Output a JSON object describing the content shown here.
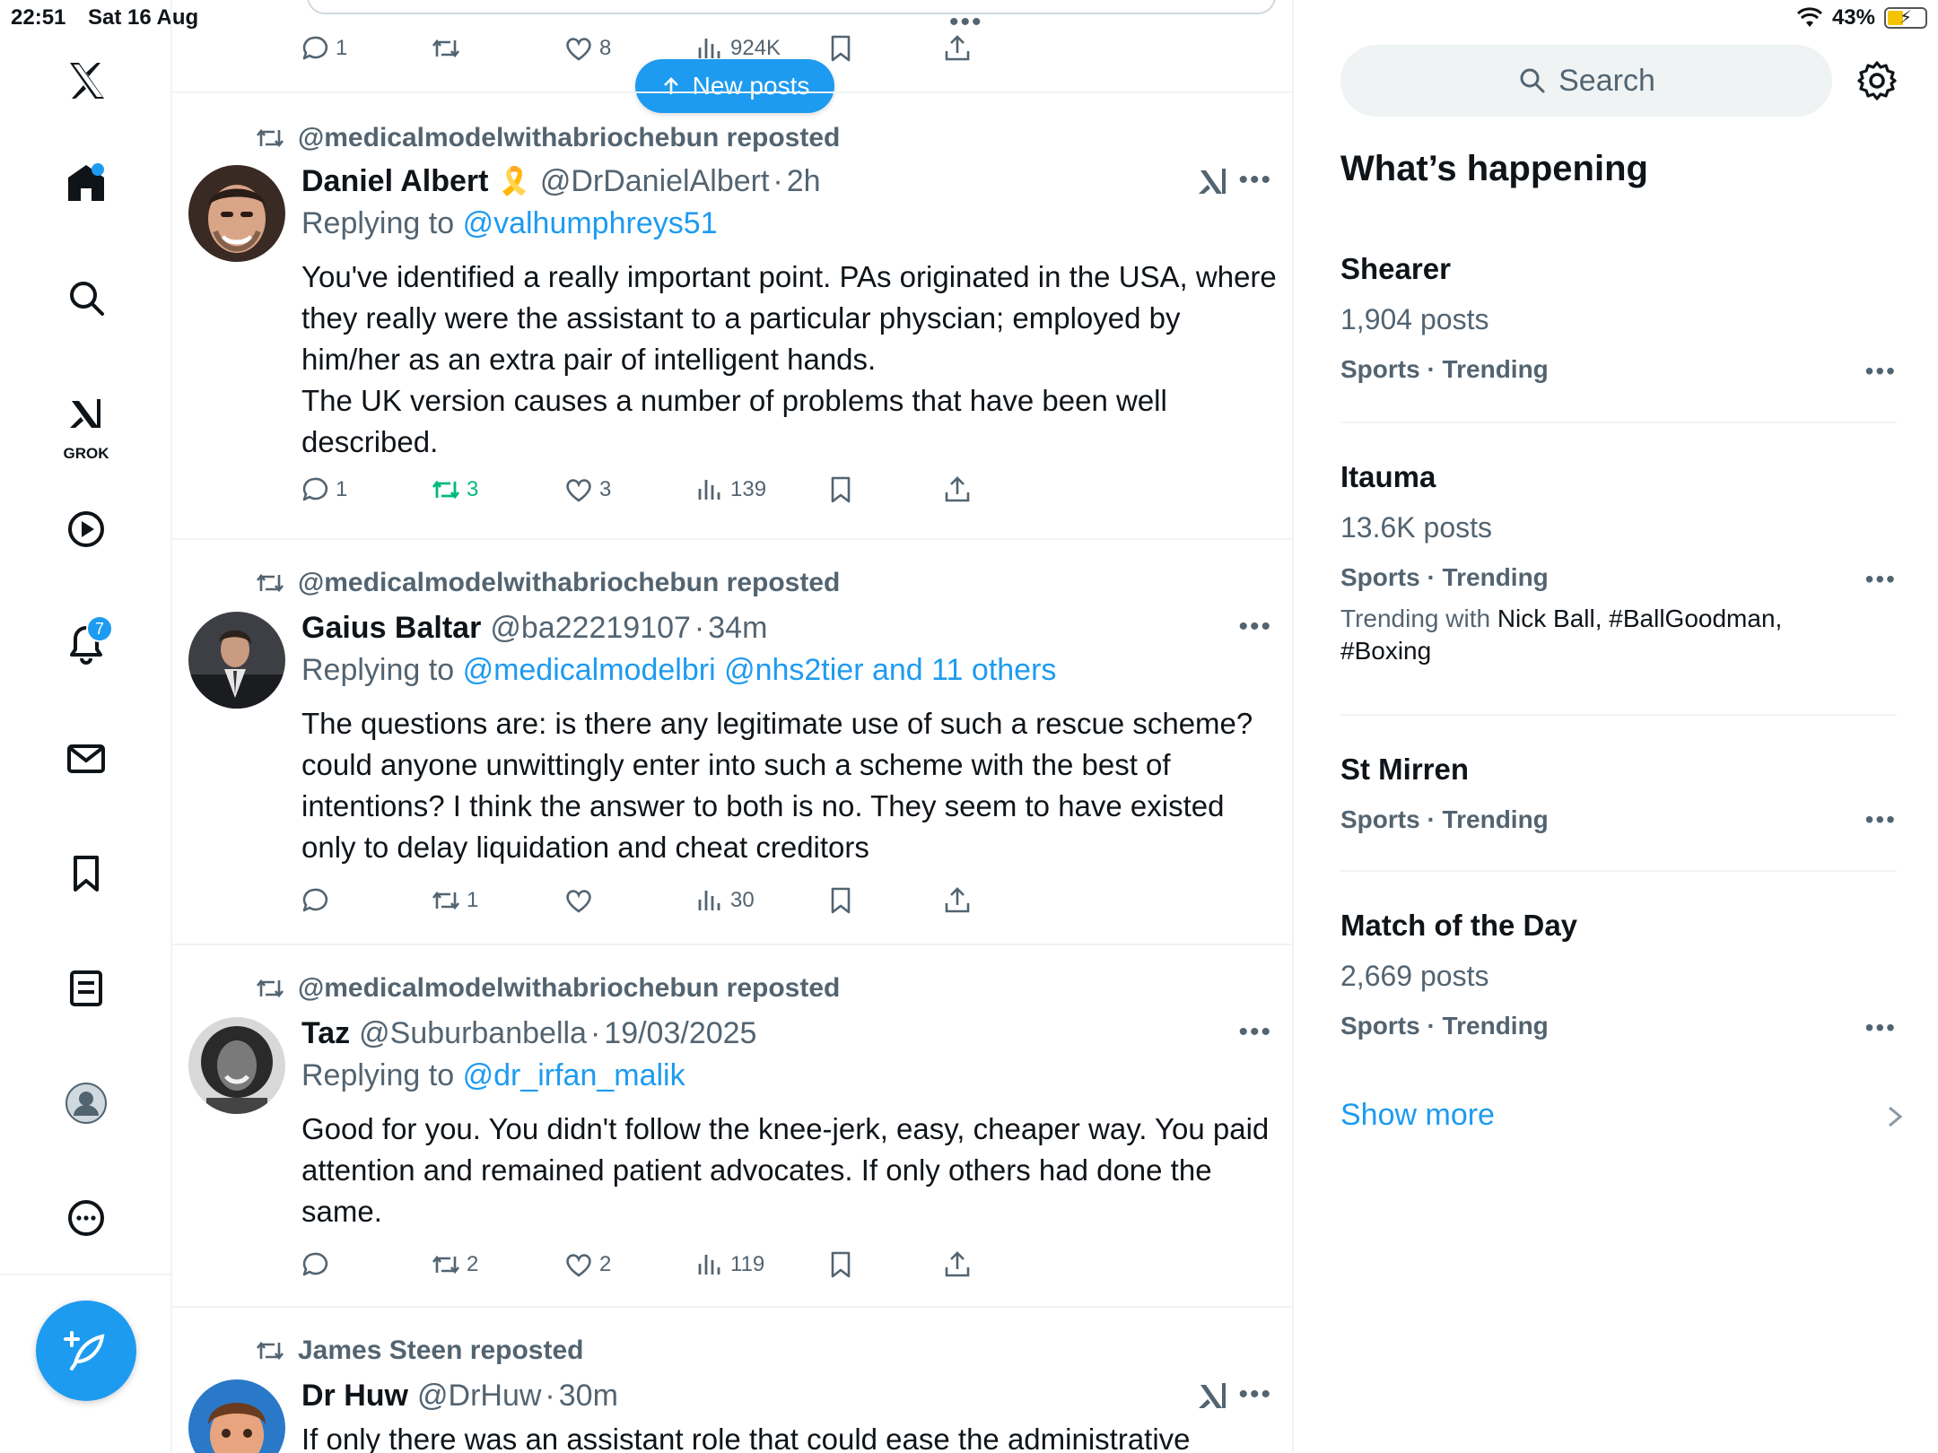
{
  "status_bar": {
    "time": "22:51",
    "date": "Sat 16 Aug",
    "battery": "43%",
    "battery_level": 0.43
  },
  "nav": {
    "items": [
      {
        "name": "x-logo",
        "icon": "x-logo-icon"
      },
      {
        "name": "home",
        "icon": "home-icon",
        "has_dot": true
      },
      {
        "name": "explore",
        "icon": "search-icon"
      },
      {
        "name": "grok",
        "icon": "grok-icon",
        "label": "GROK"
      },
      {
        "name": "videos",
        "icon": "play-icon"
      },
      {
        "name": "notifications",
        "icon": "bell-icon",
        "badge": "7"
      },
      {
        "name": "messages",
        "icon": "mail-icon"
      },
      {
        "name": "bookmarks",
        "icon": "bookmark-icon"
      },
      {
        "name": "lists",
        "icon": "list-icon"
      },
      {
        "name": "profile",
        "icon": "profile-icon"
      },
      {
        "name": "more",
        "icon": "more-circle-icon"
      }
    ],
    "compose_icon": "compose-feather-icon"
  },
  "feed": {
    "new_posts_label": "New posts",
    "top_actions": {
      "replies": "1",
      "reposts": "",
      "likes": "8",
      "views": "924K"
    },
    "tweets": [
      {
        "reposted_by": "@medicalmodelwithabriochebun reposted",
        "name": "Daniel Albert",
        "emoji": "🎗️",
        "handle": "@DrDanielAlbert",
        "separator": "·",
        "time": "2h",
        "replying_prefix": "Replying to",
        "replying_to": "@valhumphreys51",
        "body": "You've identified a really important point. PAs originated in the USA, where they really were the assistant to a particular physcian; employed by him/her as an extra pair of intelligent hands.\nThe UK version causes a number of problems that have been well described.",
        "replies": "1",
        "reposts": "3",
        "likes": "3",
        "views": "139",
        "reposted_by_me": true
      },
      {
        "reposted_by": "@medicalmodelwithabriochebun reposted",
        "name": "Gaius Baltar",
        "handle": "@ba22219107",
        "separator": "·",
        "time": "34m",
        "replying_prefix": "Replying to",
        "replying_to": "@medicalmodelbri @nhs2tier and 11 others",
        "body": "The questions are: is there any legitimate use of such a rescue scheme? could anyone unwittingly enter into such a scheme with the best of intentions? I think the answer to both is no. They seem to have existed only to delay liquidation and cheat creditors",
        "replies": "",
        "reposts": "1",
        "likes": "",
        "views": "30"
      },
      {
        "reposted_by": "@medicalmodelwithabriochebun reposted",
        "name": "Taz",
        "handle": "@Suburbanbella",
        "separator": "·",
        "time": "19/03/2025",
        "replying_prefix": "Replying to",
        "replying_to": "@dr_irfan_malik",
        "body": "Good for you. You didn't follow the knee-jerk, easy, cheaper way. You paid attention and remained patient advocates. If only others had done the same.",
        "replies": "",
        "reposts": "2",
        "likes": "2",
        "views": "119"
      },
      {
        "reposted_by": "James Steen reposted",
        "name": "Dr Huw",
        "handle": "@DrHuw",
        "separator": "·",
        "time": "30m",
        "body": "If only there was an assistant role that could ease the administrative"
      }
    ]
  },
  "right": {
    "search_placeholder": "Search",
    "settings_icon": "gear-icon",
    "section_title": "What’s happening",
    "trends": [
      {
        "name": "Shearer",
        "count": "1,904 posts",
        "category": "Sports · Trending"
      },
      {
        "name": "Itauma",
        "count": "13.6K posts",
        "category": "Sports · Trending",
        "with_prefix": "Trending with",
        "with_names": "Nick Ball, #BallGoodman,",
        "with_names_2": "#Boxing"
      },
      {
        "name": "St Mirren",
        "category": "Sports · Trending"
      },
      {
        "name": "Match of the Day",
        "count": "2,669 posts",
        "category": "Sports · Trending"
      }
    ],
    "show_more": "Show more"
  },
  "colors": {
    "accent": "#1d9bf0",
    "text_primary": "#0f1419",
    "text_secondary": "#536471",
    "repost_green": "#00ba7c",
    "divider": "#eff3f4"
  }
}
